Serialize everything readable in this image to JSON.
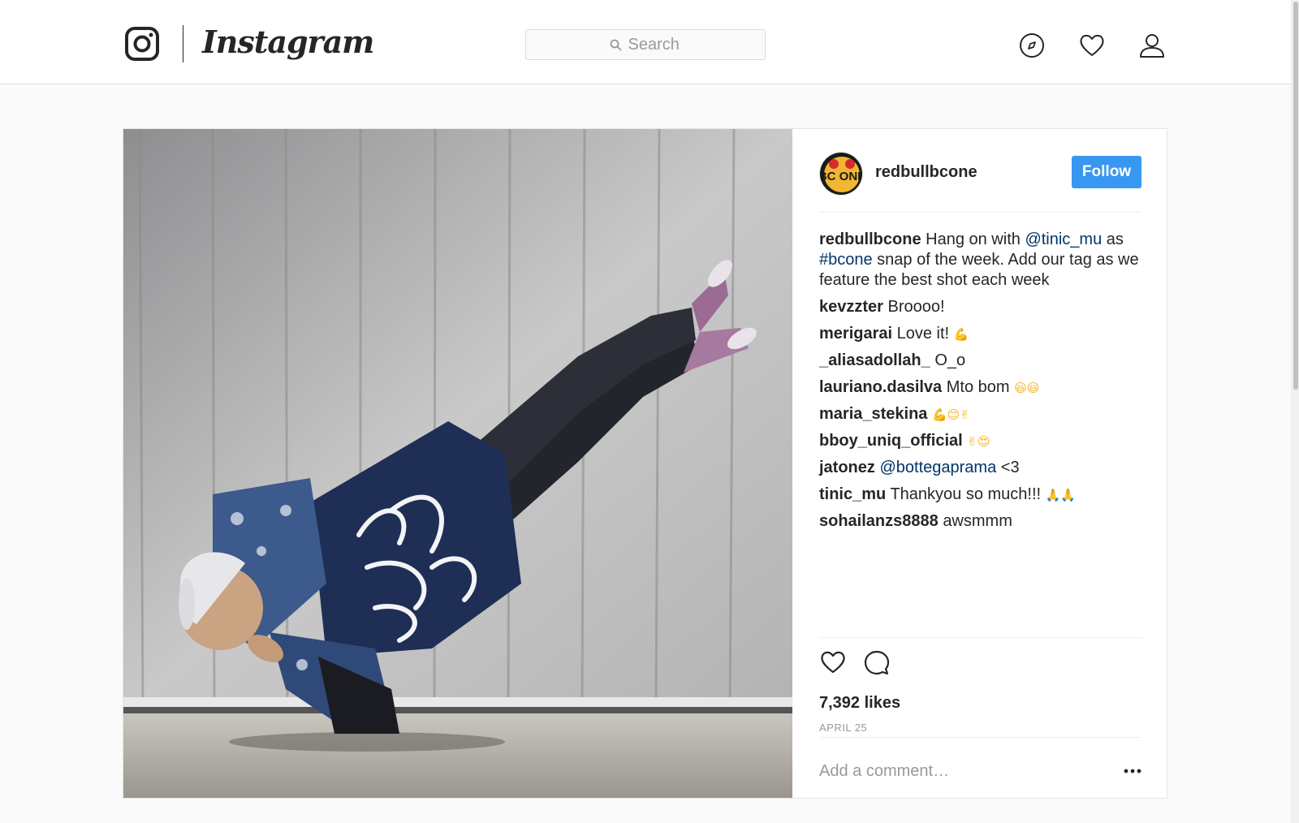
{
  "header": {
    "wordmark": "Instagram",
    "search": {
      "placeholder": "Search"
    },
    "icons": [
      "instagram-logo-icon",
      "compass-icon",
      "heart-icon",
      "person-icon"
    ]
  },
  "post": {
    "author": "redbullbcone",
    "avatar_text": "BC ONE",
    "follow_label": "Follow",
    "caption": {
      "username": "redbullbcone",
      "text_1": " Hang on with ",
      "mention": "@tinic_mu",
      "text_2": " as ",
      "hashtag": "#bcone",
      "text_3": " snap of the week. Add our tag as we feature the best shot each week"
    },
    "comments": [
      {
        "user": "kevzzter",
        "text": "Broooo!",
        "emoji": ""
      },
      {
        "user": "merigarai",
        "text": "Love it!",
        "emoji": "💪"
      },
      {
        "user": "_aliasadollah_",
        "text": "O_o",
        "emoji": ""
      },
      {
        "user": "lauriano.dasilva",
        "text": "Mto bom",
        "emoji": "😃😃"
      },
      {
        "user": "maria_stekina",
        "text": "",
        "emoji": "💪😊✌"
      },
      {
        "user": "bboy_uniq_official",
        "text": "",
        "emoji": "✌😍"
      },
      {
        "user": "jatonez",
        "text": "<3",
        "mention": "@bottegaprama",
        "emoji": ""
      },
      {
        "user": "tinic_mu",
        "text": "Thankyou so much!!!",
        "emoji": "🙏🙏"
      },
      {
        "user": "sohailanzs8888",
        "text": "awsmmm",
        "emoji": ""
      }
    ],
    "likes": "7,392 likes",
    "date": "APRIL 25",
    "add_comment_placeholder": "Add a comment…",
    "action_icons": [
      "heart-icon",
      "comment-icon",
      "more-icon"
    ]
  },
  "colors": {
    "accent": "#3897f0",
    "link": "#003569",
    "text": "#262626",
    "muted": "#999999",
    "border": "#dbdbdb"
  }
}
